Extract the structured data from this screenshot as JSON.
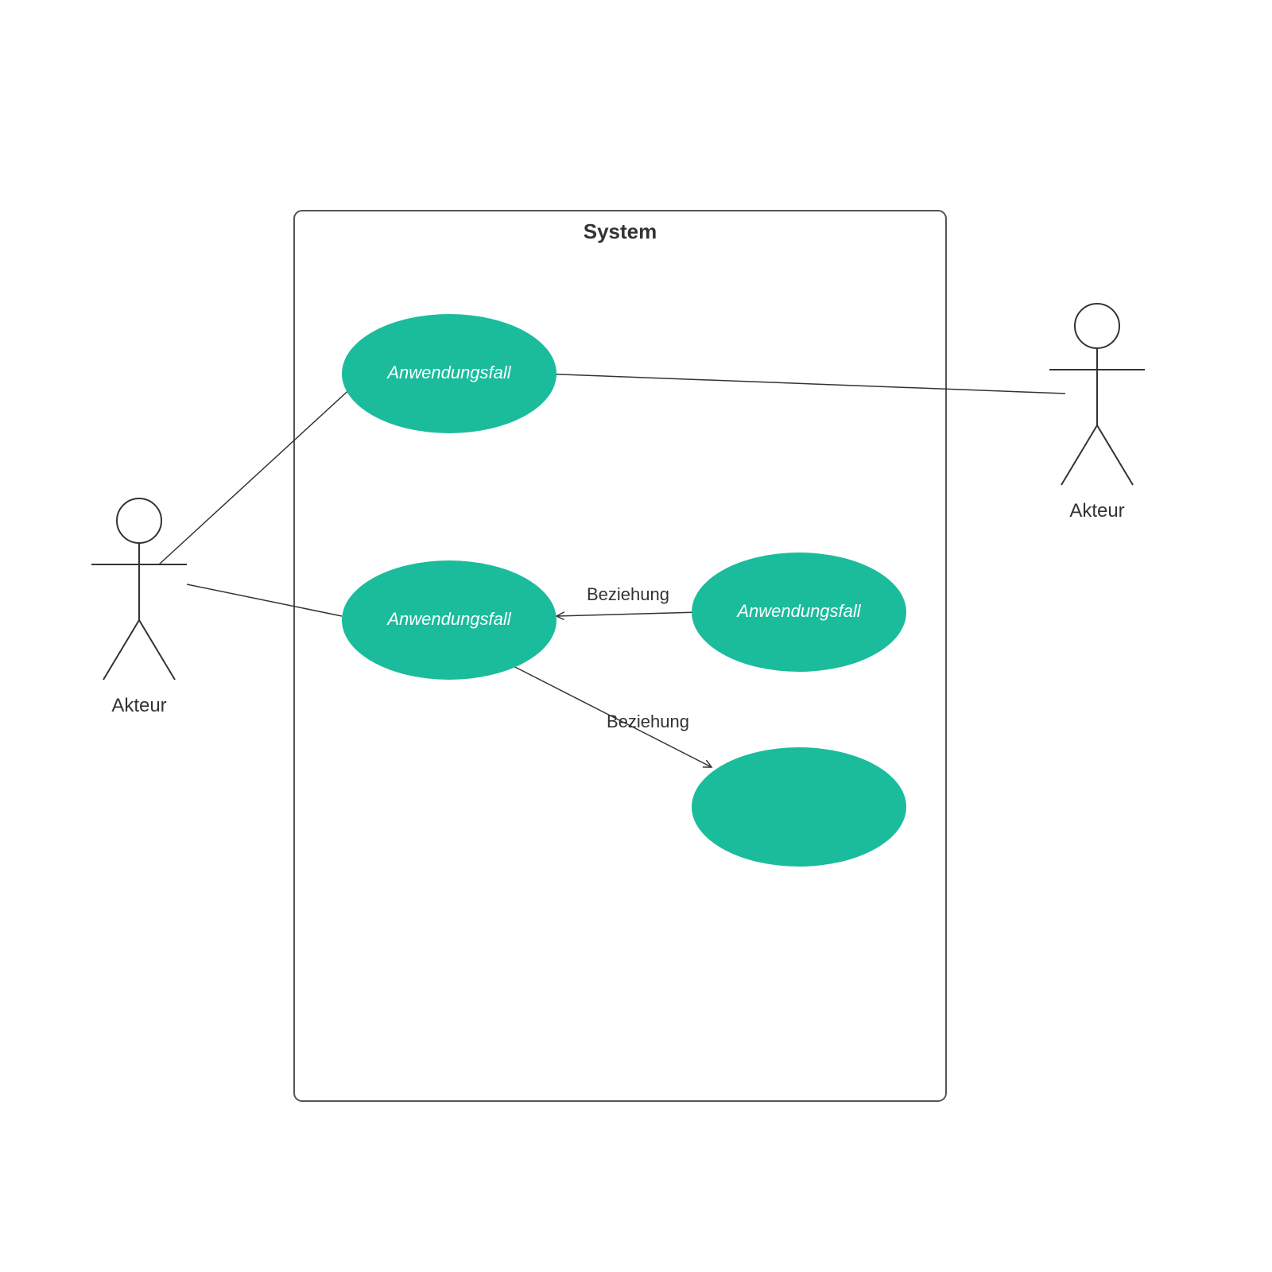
{
  "diagram": {
    "type": "uml-use-case",
    "system": {
      "title": "System"
    },
    "actors": {
      "left": {
        "label": "Akteur"
      },
      "right": {
        "label": "Akteur"
      }
    },
    "usecases": {
      "uc1": {
        "label": "Anwendungsfall"
      },
      "uc2": {
        "label": "Anwendungsfall"
      },
      "uc3": {
        "label": "Anwendungsfall"
      },
      "uc4": {
        "label": ""
      }
    },
    "relations": {
      "r1": {
        "label": "Beziehung"
      },
      "r2": {
        "label": "Beziehung"
      }
    },
    "colors": {
      "usecaseFill": "#1ABC9C",
      "stroke": "#333333"
    }
  }
}
